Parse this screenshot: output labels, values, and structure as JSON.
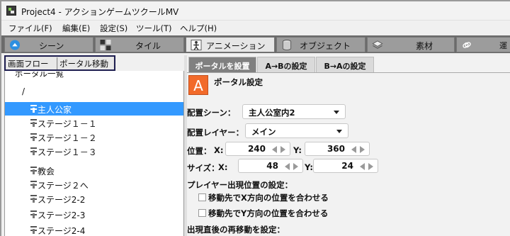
{
  "window": {
    "title": "Project4 - アクションゲームツクールMV"
  },
  "menu": [
    "ファイル(F)",
    "編集(E)",
    "設定(S)",
    "ツール(T)",
    "ヘルプ(H)"
  ],
  "top_tabs": [
    "シーン",
    "タイル",
    "アニメーション",
    "オブジェクト",
    "素材",
    "運"
  ],
  "left_panel": {
    "tabs": [
      "画面フロー",
      "ポータル移動"
    ],
    "tree_root": "ポータル一覧",
    "tree_folder": "/",
    "items": [
      "主人公家",
      "ステージ１－１",
      "ステージ１－２",
      "ステージ１－３",
      "教会",
      "ステージ２へ",
      "ステージ2-2",
      "ステージ2-3",
      "ステージ2-4"
    ],
    "selected_index": 0
  },
  "right_panel": {
    "tabs": [
      "ポータルを設置",
      "A→Bの設定",
      "B→Aの設定"
    ],
    "section_icon": "A",
    "section_title": "ポータル設定",
    "scene_label": "配置シーン：",
    "scene_value": "主人公室内2",
    "layer_label": "配置レイヤー：",
    "layer_value": "メイン",
    "position_label": "位置：",
    "position_x_label": "X:",
    "position_x": "240",
    "position_y_label": "Y:",
    "position_y": "360",
    "size_label": "サイズ：",
    "size_x_label": "X:",
    "size_x": "48",
    "size_y_label": "Y:",
    "size_y": "24",
    "player_pos_heading": "プレイヤー出現位置の設定：",
    "check_x_label": "移動先でX方向の位置を合わせる",
    "check_y_label": "移動先でY方向の位置を合わせる",
    "remove_heading": "出現直後の再移動を設定："
  },
  "colors": {
    "selection": "#3399ff",
    "accent_icon": "#f26a2a",
    "highlight_border": "#1e1e50"
  }
}
